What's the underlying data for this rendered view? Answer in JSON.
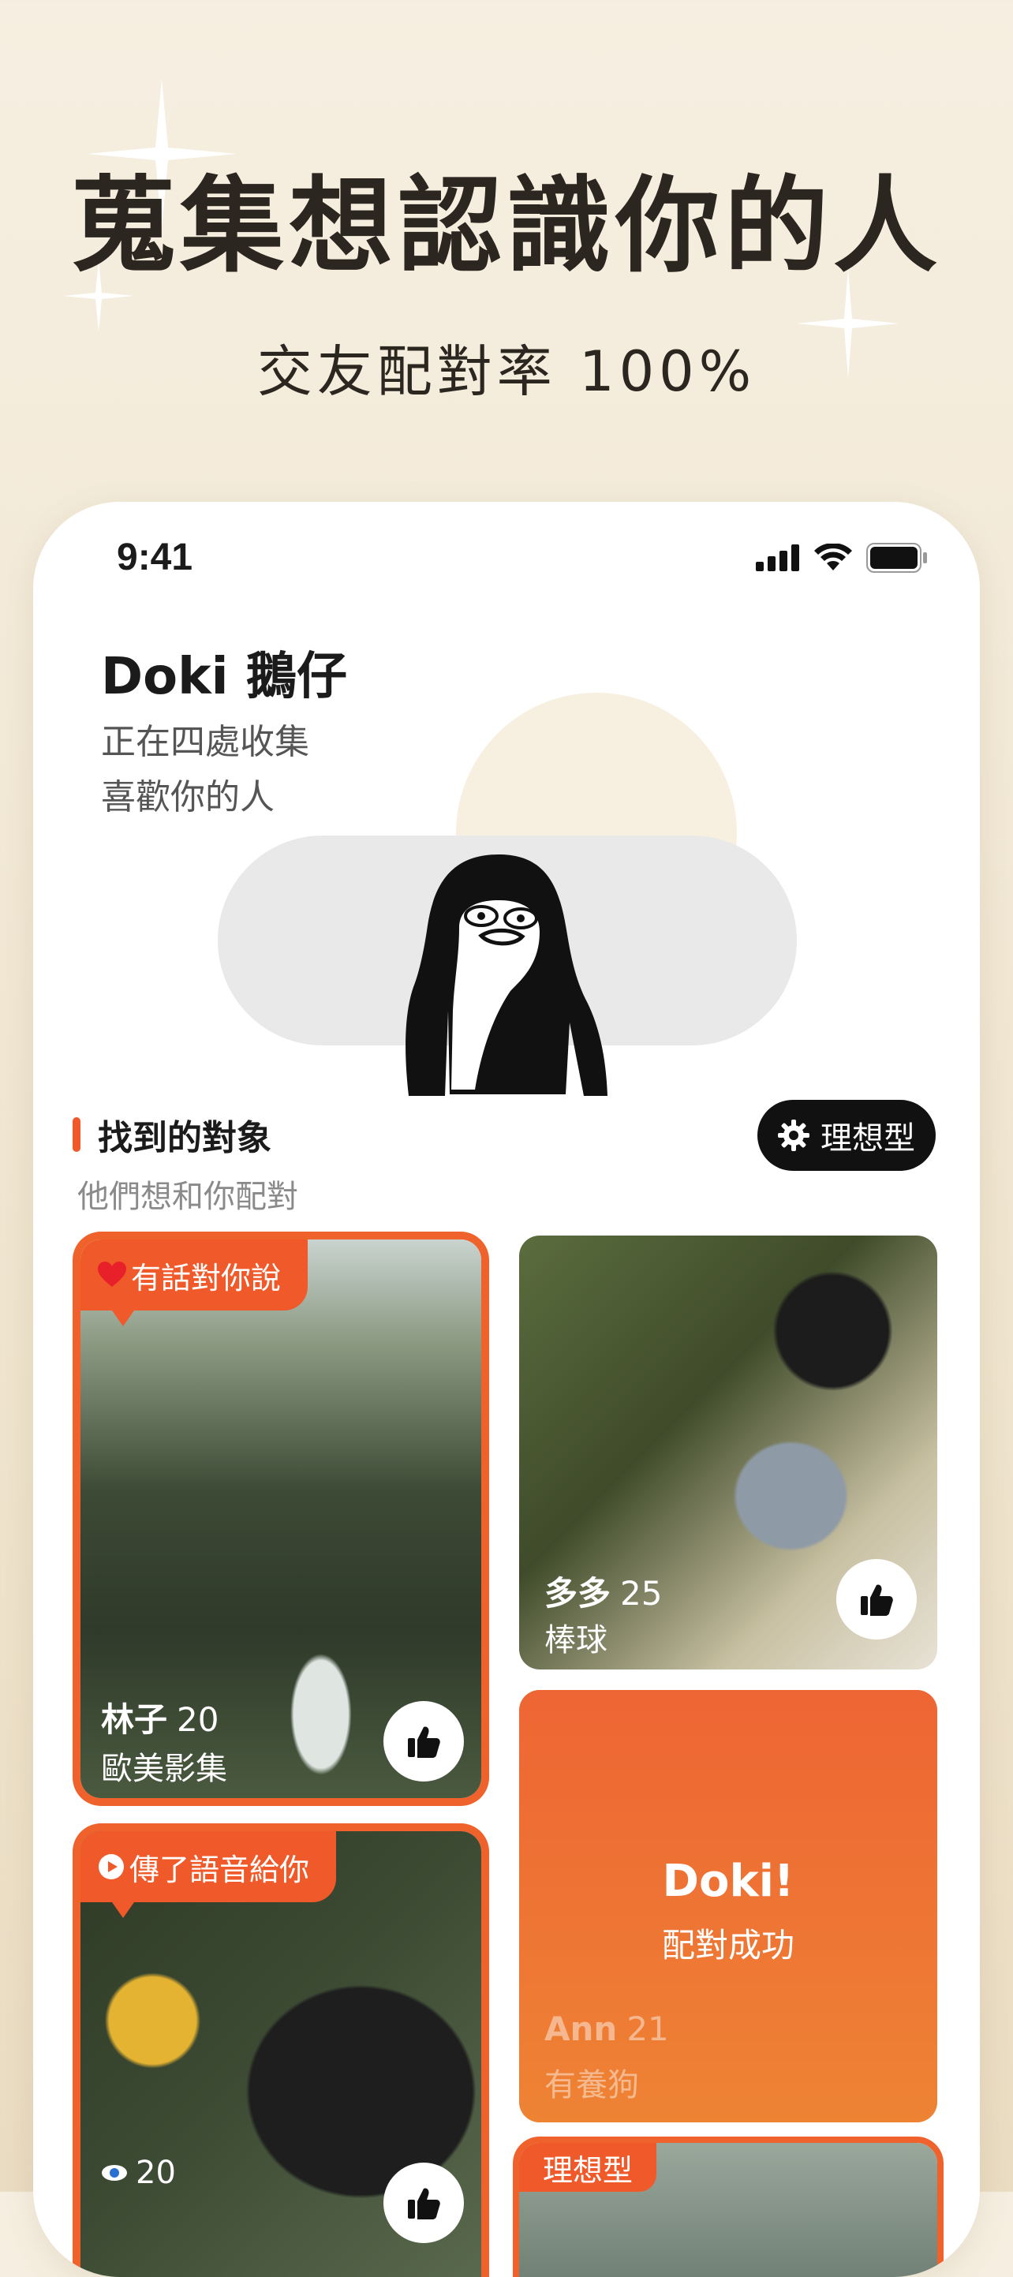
{
  "hero": {
    "title": "蒐集想認識你的人",
    "subtitle": "交友配對率 100%"
  },
  "status_bar": {
    "time": "9:41"
  },
  "profile": {
    "name": "Doki 鵝仔",
    "tagline_line1": "正在四處收集",
    "tagline_line2": "喜歡你的人"
  },
  "section": {
    "title": "找到的對象",
    "subtitle": "他們想和你配對",
    "ideal_button": "理想型"
  },
  "cards": [
    {
      "bubble": "有話對你說",
      "name": "林子",
      "age": "20",
      "tag": "歐美影集"
    },
    {
      "name": "多多",
      "age": "25",
      "tag": "棒球"
    },
    {
      "match_title": "Doki!",
      "match_sub": "配對成功",
      "name": "Ann",
      "age": "21",
      "tag": "有養狗"
    },
    {
      "bubble": "傳了語音給你",
      "views": "20"
    },
    {
      "tag": "理想型"
    }
  ],
  "colors": {
    "accent": "#f05a2a",
    "dark": "#111111",
    "bg": "#f6efe1"
  },
  "icons": [
    "sparkle-icon",
    "signal-icon",
    "wifi-icon",
    "battery-icon",
    "gear-icon",
    "heart-icon",
    "play-icon",
    "thumbs-up-icon",
    "eye-icon",
    "penguin-mascot"
  ]
}
